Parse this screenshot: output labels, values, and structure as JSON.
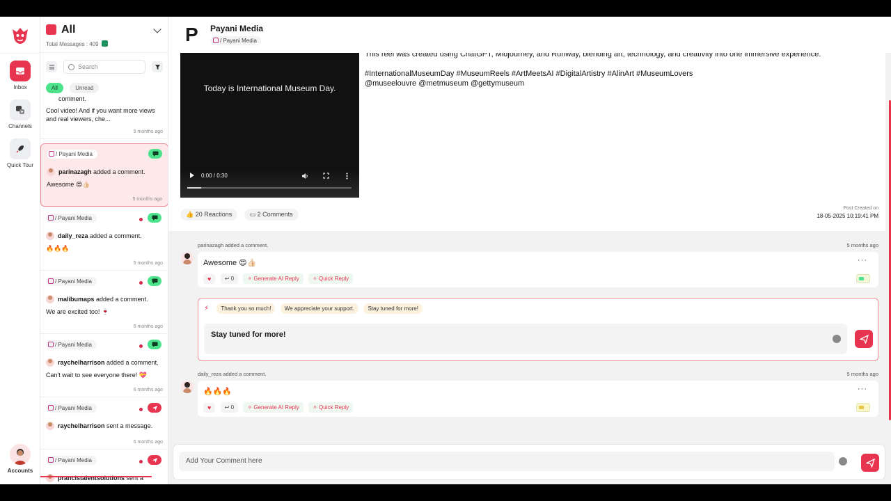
{
  "rail": {
    "items": [
      {
        "label": "Inbox",
        "icon": "inbox-icon"
      },
      {
        "label": "Channels",
        "icon": "channels-icon"
      },
      {
        "label": "Quick Tour",
        "icon": "rocket-icon"
      },
      {
        "label": "Accounts",
        "icon": "avatar-icon"
      }
    ]
  },
  "list": {
    "title": "All",
    "total": "Total Messages : 409",
    "search_placeholder": "Search",
    "filters": [
      "All",
      "Unread"
    ],
    "first_partial": {
      "txt1": "comment.",
      "txt2": "Cool video! And if you want more views and real viewers, che...",
      "time": "5 months ago"
    },
    "items": [
      {
        "source": "/ Payani Media",
        "user": "parinazagh",
        "action": " added a comment.",
        "text": "Awesome 😍👍🏻",
        "time": "5 months ago",
        "type": "comment"
      },
      {
        "source": "/ Payani Media",
        "user": "daily_reza",
        "action": " added a comment.",
        "text": "🔥🔥🔥",
        "time": "5 months ago",
        "type": "comment"
      },
      {
        "source": "/ Payani Media",
        "user": "malibumaps",
        "action": " added a comment.",
        "text": "We are excited too! 🍷",
        "time": "6 months ago",
        "type": "comment"
      },
      {
        "source": "/ Payani Media",
        "user": "raychelharrison",
        "action": " added a comment.",
        "text": "Can't wait to see everyone there! 💝",
        "time": "6 months ago",
        "type": "comment"
      },
      {
        "source": "/ Payani Media",
        "user": "raychelharrison",
        "action": " sent a message.",
        "text": "",
        "time": "6 months ago",
        "type": "message"
      },
      {
        "source": "/ Payani Media",
        "user": "prancistalentsolutions",
        "action": " sent a",
        "text": "",
        "time": "",
        "type": "message"
      }
    ]
  },
  "header": {
    "page_name": "Payani Media",
    "page_sub": "/ Payani Media"
  },
  "post": {
    "video_caption": "Today is International Museum Day.",
    "video_time": "0:00 / 0:30",
    "desc_line1": "This reel was created using ChatGPT, Midjourney, and Runway, blending art, technology, and creativity into one immersive experience.",
    "hashtags": "#InternationalMuseumDay #MuseumReels #ArtMeetsAI #DigitalArtistry #AlinArt #MuseumLovers",
    "mentions": "@museelouvre @metmuseum @gettymuseum",
    "reactions": "20 Reactions",
    "comments": "2 Comments",
    "created_label": "Post Created on",
    "created_date": "18-05-2025 10:19:41 PM"
  },
  "thread": {
    "c1": {
      "meta": "parinazagh added a comment.",
      "time": "5 months ago",
      "text": "Awesome 😍👍🏻",
      "replies": "0",
      "ai_label": "Generate AI Reply",
      "qr_label": "Quick Reply"
    },
    "suggestions": [
      "Thank you so much!",
      "We appreciate your support.",
      "Stay tuned for more!"
    ],
    "reply_value": "Stay tuned for more!",
    "c2": {
      "meta": "daily_reza added a comment.",
      "time": "5 months ago",
      "text": "🔥🔥🔥",
      "replies": "0",
      "ai_label": "Generate AI Reply",
      "qr_label": "Quick Reply"
    }
  },
  "composer": {
    "placeholder": "Add Your Comment here"
  },
  "colors": {
    "accent": "#e8354f",
    "green": "#4de38d"
  }
}
